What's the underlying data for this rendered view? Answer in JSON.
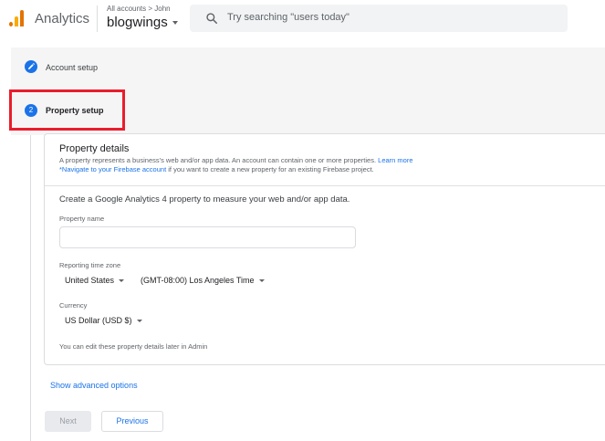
{
  "header": {
    "app_title": "Analytics",
    "breadcrumb": "All accounts > John",
    "account_name": "blogwings",
    "search_placeholder": "Try searching \"users today\""
  },
  "steps": [
    {
      "label": "Account setup",
      "status": "completed",
      "icon": "pencil-icon"
    },
    {
      "label": "Property setup",
      "status": "current",
      "number": "2",
      "highlighted": true
    }
  ],
  "property_details": {
    "title": "Property details",
    "description": "A property represents a business's web and/or app data. An account can contain one or more properties.",
    "learn_more": "Learn more",
    "firebase_link": "*Navigate to your Firebase account",
    "firebase_suffix": " if you want to create a new property for an existing Firebase project.",
    "create_text": "Create a Google Analytics 4 property to measure your web and/or app data.",
    "property_name_label": "Property name",
    "property_name_value": "",
    "timezone_label": "Reporting time zone",
    "country": "United States",
    "timezone": "(GMT-08:00) Los Angeles Time",
    "currency_label": "Currency",
    "currency": "US Dollar (USD $)",
    "note": "You can edit these property details later in Admin"
  },
  "actions": {
    "advanced": "Show advanced options",
    "next": "Next",
    "previous": "Previous"
  },
  "colors": {
    "accent": "#1a73e8",
    "highlight": "#ea1d2c",
    "logo_orange": "#f9ab00",
    "logo_dark_orange": "#e37400"
  }
}
